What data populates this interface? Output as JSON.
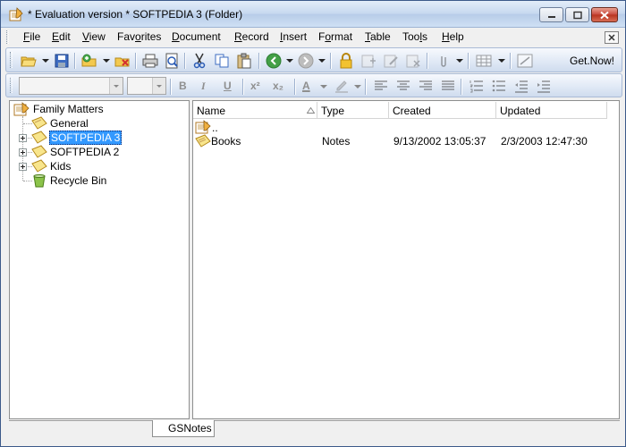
{
  "window": {
    "title": "* Evaluation version * SOFTPEDIA 3 (Folder)"
  },
  "menu": [
    {
      "id": "file",
      "pre": "",
      "ul": "F",
      "post": "ile"
    },
    {
      "id": "edit",
      "pre": "",
      "ul": "E",
      "post": "dit"
    },
    {
      "id": "view",
      "pre": "",
      "ul": "V",
      "post": "iew"
    },
    {
      "id": "favorites",
      "pre": "Fav",
      "ul": "o",
      "post": "rites"
    },
    {
      "id": "document",
      "pre": "",
      "ul": "D",
      "post": "ocument"
    },
    {
      "id": "record",
      "pre": "",
      "ul": "R",
      "post": "ecord"
    },
    {
      "id": "insert",
      "pre": "",
      "ul": "I",
      "post": "nsert"
    },
    {
      "id": "format",
      "pre": "F",
      "ul": "o",
      "post": "rmat"
    },
    {
      "id": "table",
      "pre": "",
      "ul": "T",
      "post": "able"
    },
    {
      "id": "tools",
      "pre": "Too",
      "ul": "l",
      "post": "s"
    },
    {
      "id": "help",
      "pre": "",
      "ul": "H",
      "post": "elp"
    }
  ],
  "toolbar": {
    "get_now_label": "Get.Now!",
    "icons": [
      "open-icon",
      "save-icon",
      "new-folder-icon",
      "delete-icon",
      "print-icon",
      "print-preview-icon",
      "cut-icon",
      "copy-icon",
      "paste-icon",
      "back-icon",
      "forward-icon",
      "lock-icon",
      "new-note-icon",
      "edit-note-icon",
      "delete-note-icon",
      "attach-icon",
      "table-icon",
      "link-icon"
    ]
  },
  "format_toolbar": {
    "font_value": "",
    "size_value": "",
    "bold": "B",
    "italic": "I",
    "underline": "U",
    "superscript": "x²",
    "subscript": "x₂",
    "font_color": "A"
  },
  "tree": {
    "root": "Family Matters",
    "items": [
      {
        "label": "General",
        "expandable": false,
        "selected": false
      },
      {
        "label": "SOFTPEDIA 3",
        "expandable": true,
        "selected": true
      },
      {
        "label": "SOFTPEDIA 2",
        "expandable": true,
        "selected": false
      },
      {
        "label": "Kids",
        "expandable": true,
        "selected": false
      },
      {
        "label": "Recycle Bin",
        "expandable": false,
        "selected": false
      }
    ]
  },
  "list": {
    "columns": [
      "Name",
      "Type",
      "Created",
      "Updated"
    ],
    "rows": [
      {
        "name": "..",
        "type": "",
        "created": "",
        "updated": ""
      },
      {
        "name": "Books",
        "type": "Notes",
        "created": "9/13/2002 13:05:37",
        "updated": "2/3/2003 12:47:30"
      }
    ]
  },
  "tabs": [
    "GSNotes"
  ],
  "colors": {
    "selection": "#3399ff",
    "folder": "#f8e58c",
    "title_bar": "#c6d8ef"
  }
}
